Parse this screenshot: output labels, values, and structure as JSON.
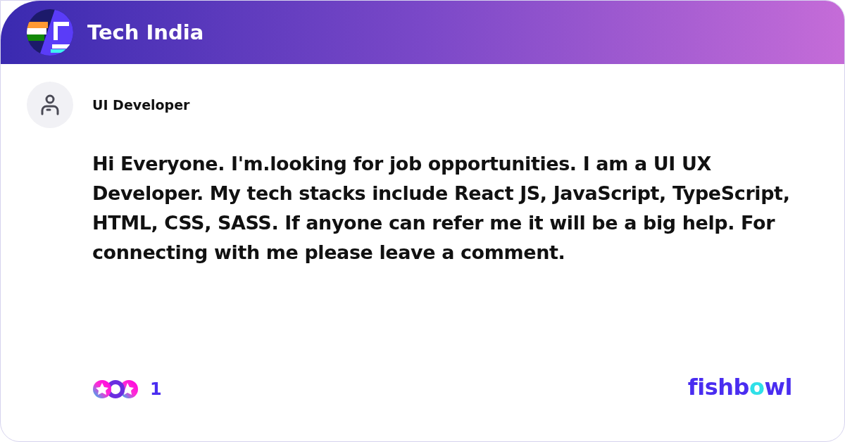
{
  "header": {
    "title": "Tech India"
  },
  "author": {
    "name": "UI Developer"
  },
  "post": {
    "text": "Hi Everyone. I'm.looking for job opportunities. I am a UI UX Developer. My tech stacks include React JS, JavaScript, TypeScript, HTML, CSS, SASS. If anyone can refer me it will be a big help. For connecting with me please leave a comment."
  },
  "reactions": {
    "count": "1"
  },
  "brand": {
    "parts": [
      "fishb",
      "o",
      "wl"
    ]
  }
}
